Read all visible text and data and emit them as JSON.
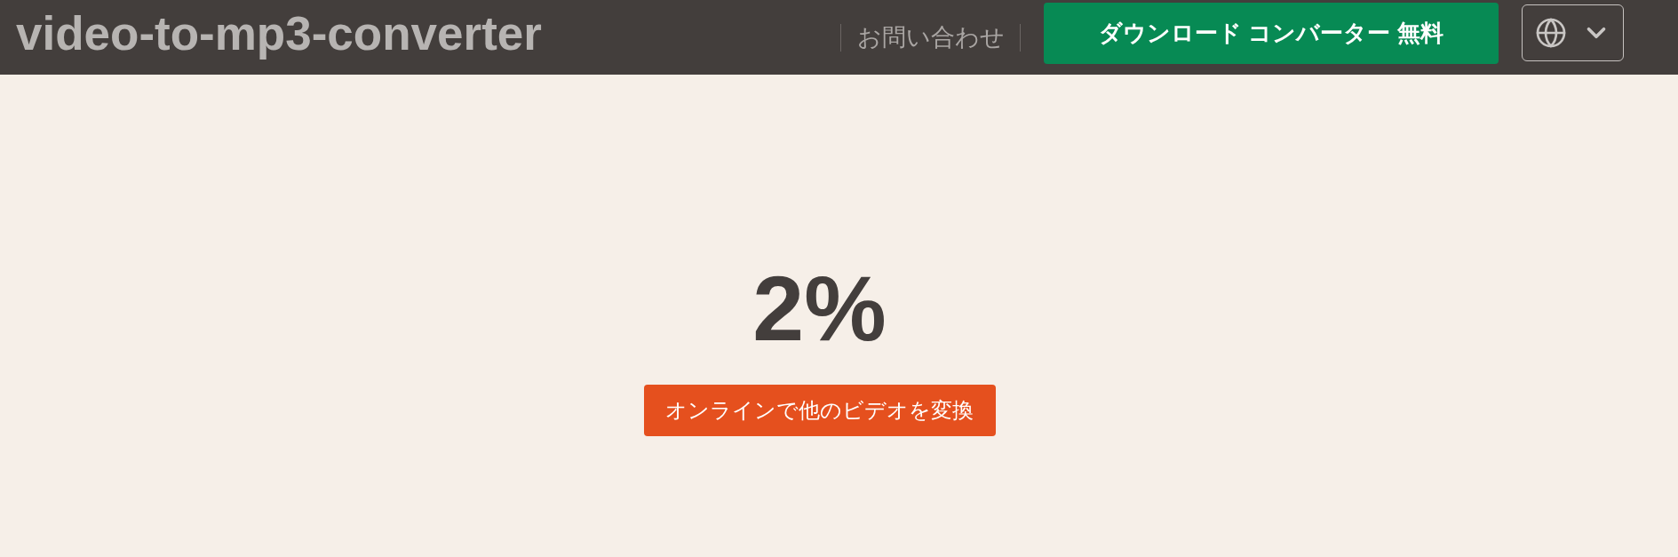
{
  "header": {
    "logo": "video-to-mp3-converter",
    "contact_link": "お問い合わせ",
    "download_button": "ダウンロード コンバーター 無料"
  },
  "progress": {
    "percent": "2%"
  },
  "convert_button": "オンラインで他のビデオを変換"
}
